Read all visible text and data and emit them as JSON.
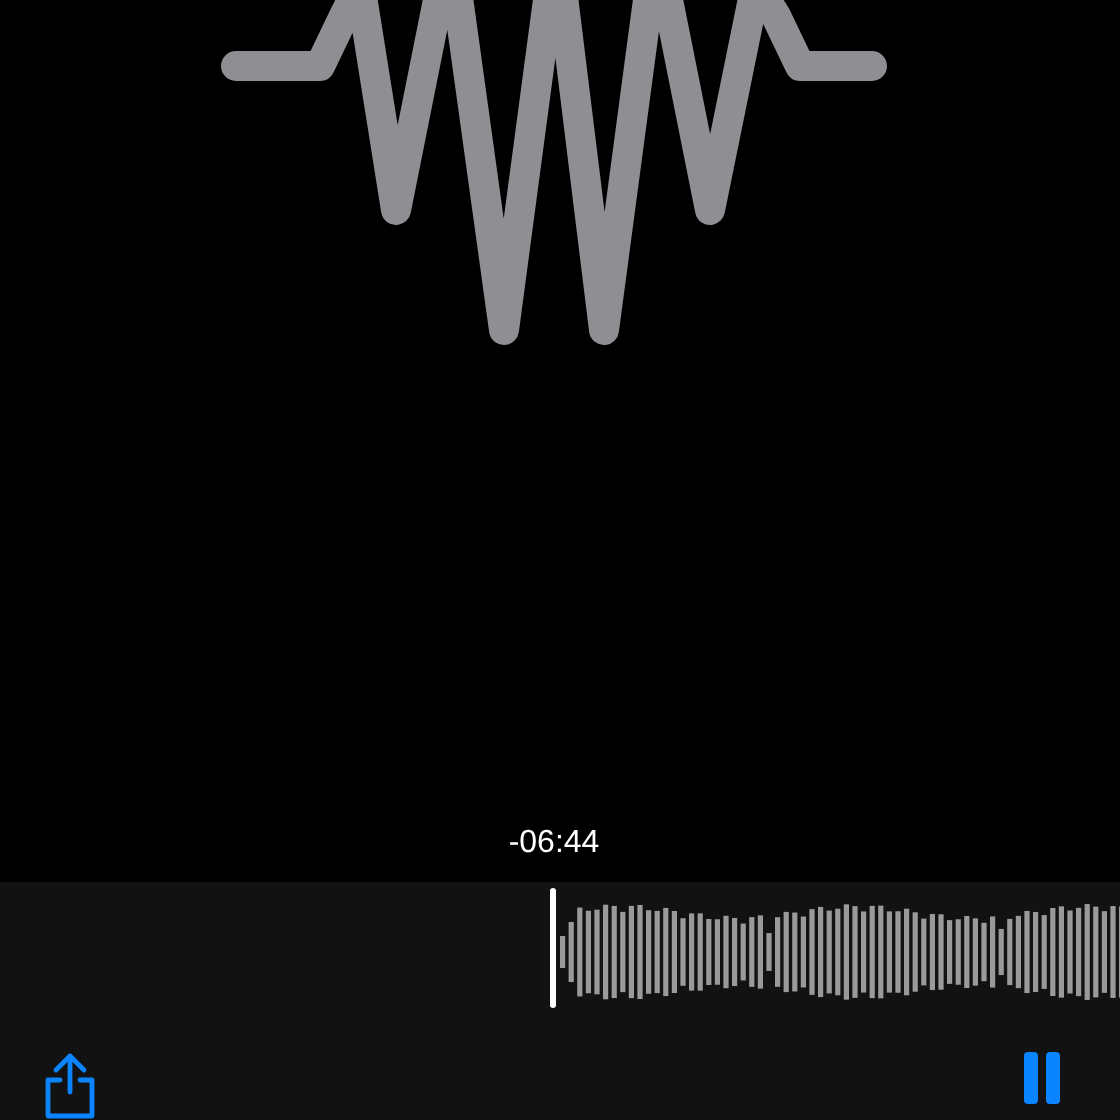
{
  "playback": {
    "time_remaining": "-06:44",
    "playing": true
  }
}
